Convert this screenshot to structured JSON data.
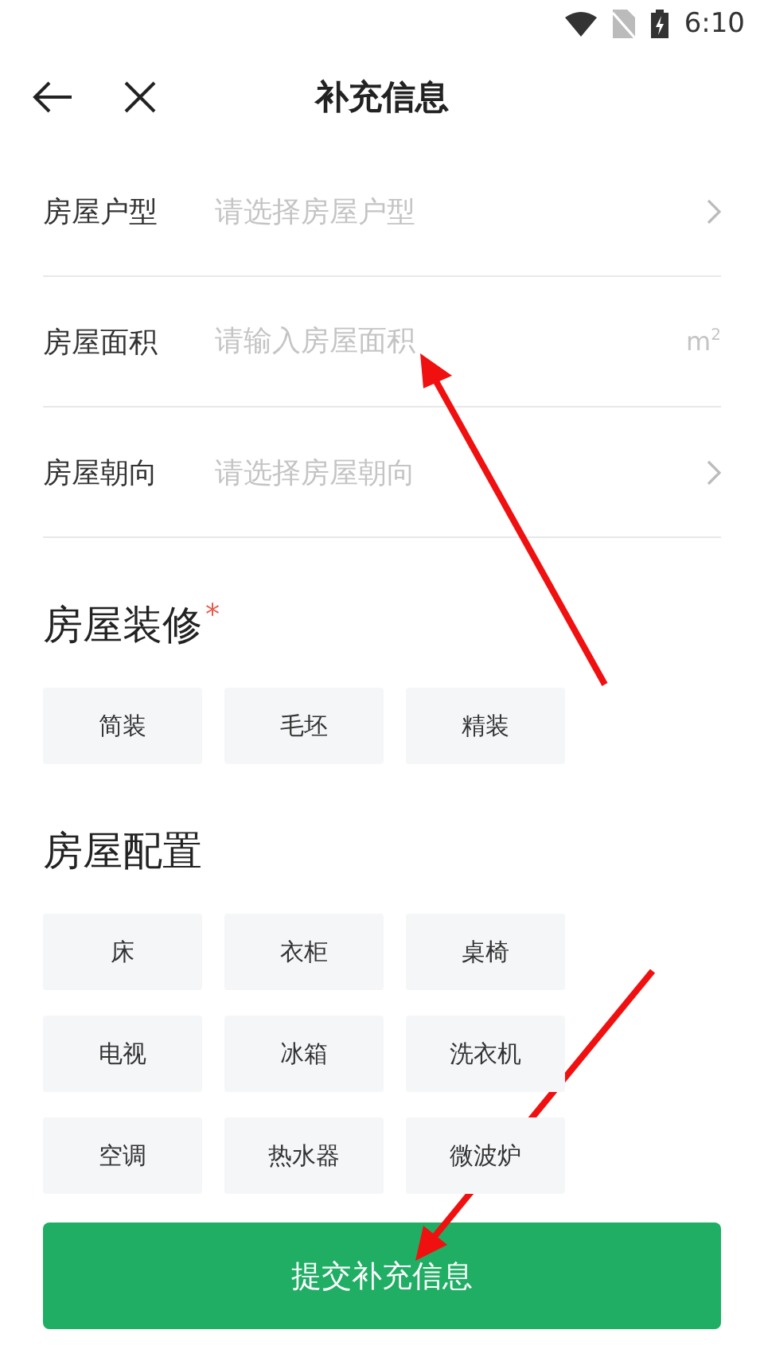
{
  "status_bar": {
    "time": "6:10"
  },
  "header": {
    "title": "补充信息"
  },
  "fields": [
    {
      "kind": "select",
      "label": "房屋户型",
      "placeholder": "请选择房屋户型"
    },
    {
      "kind": "input",
      "label": "房屋面积",
      "placeholder": "请输入房屋面积",
      "unit": "m$^{2}$"
    },
    {
      "kind": "select",
      "label": "房屋朝向",
      "placeholder": "请选择房屋朝向"
    }
  ],
  "sections": [
    {
      "title": "房屋装修",
      "required_mark": "*",
      "options": [
        {
          "label": "简装",
          "selected": false
        },
        {
          "label": "毛坯",
          "selected": false
        },
        {
          "label": "精装",
          "selected": false
        }
      ]
    },
    {
      "title": "房屋配置",
      "options": [
        {
          "label": "床",
          "selected": false
        },
        {
          "label": "衣柜",
          "selected": false
        },
        {
          "label": "桌椅",
          "selected": false
        },
        {
          "label": "电视",
          "selected": false
        },
        {
          "label": "冰箱",
          "selected": false
        },
        {
          "label": "洗衣机",
          "selected": false
        },
        {
          "label": "空调",
          "selected": false
        },
        {
          "label": "热水器",
          "selected": false
        },
        {
          "label": "微波炉",
          "selected": false
        }
      ]
    }
  ],
  "submit": {
    "label": "提交补充信息"
  }
}
